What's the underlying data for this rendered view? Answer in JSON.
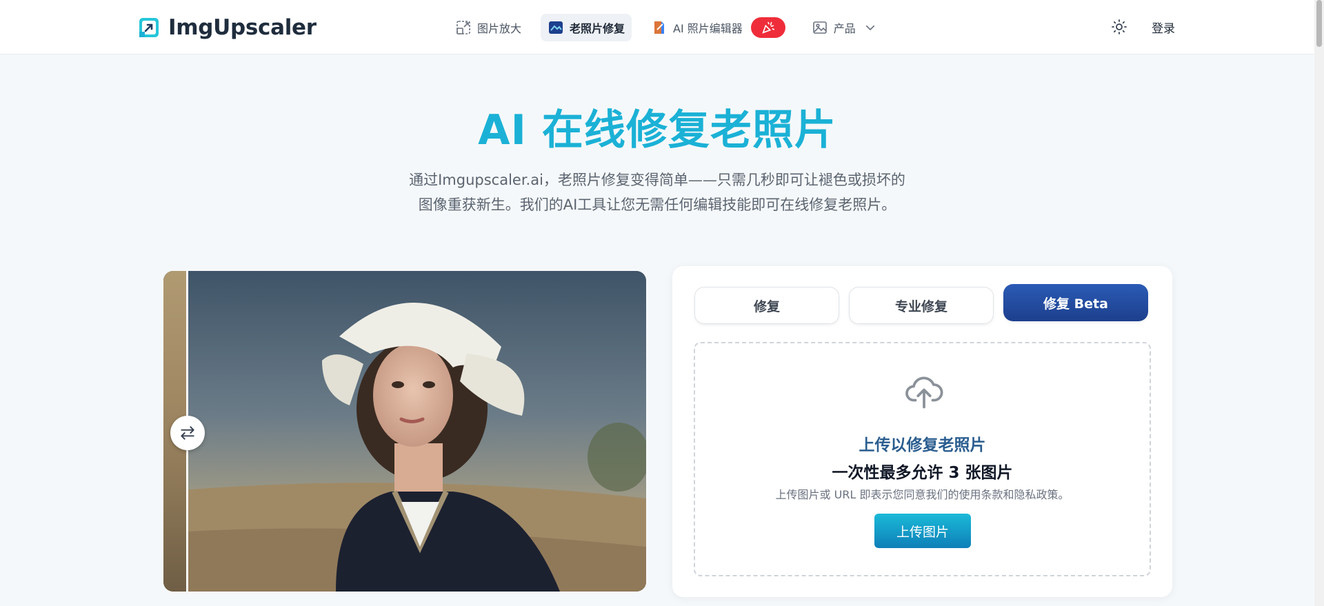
{
  "header": {
    "brand": "ImgUpscaler",
    "nav": [
      {
        "label": "图片放大",
        "icon": "image-enlarge-icon"
      },
      {
        "label": "老照片修复",
        "icon": "photo-restore-icon",
        "active": true
      },
      {
        "label": "AI 照片编辑器",
        "icon": "ai-editor-icon",
        "badge_icon": "party-popper-icon"
      },
      {
        "label": "产品",
        "icon": "gallery-icon",
        "dropdown_icon": "chevron-down-icon"
      }
    ],
    "theme_icon": "sun-icon",
    "login": "登录"
  },
  "hero": {
    "title": "AI 在线修复老照片",
    "desc_line1": "通过Imgupscaler.ai，老照片修复变得简单——只需几秒即可让褪色或损坏的",
    "desc_line2": "图像重获新生。我们的AI工具让您无需任何编辑技能即可在线修复老照片。"
  },
  "compare": {
    "handle_icon": "swap-arrows-icon",
    "split_fraction": 0.05
  },
  "upload": {
    "tabs": [
      "修复",
      "专业修复",
      "修复 Beta"
    ],
    "active_tab": 2,
    "title": "上传以修复老照片",
    "subtitle": "一次性最多允许 3 张图片",
    "note": "上传图片或 URL 即表示您同意我们的使用条款和隐私政策。",
    "button": "上传图片",
    "icon": "cloud-upload-icon"
  },
  "colors": {
    "accent": "#1bb1d6",
    "active_tab": "#1d3f8d",
    "badge": "#ef2d3a"
  }
}
